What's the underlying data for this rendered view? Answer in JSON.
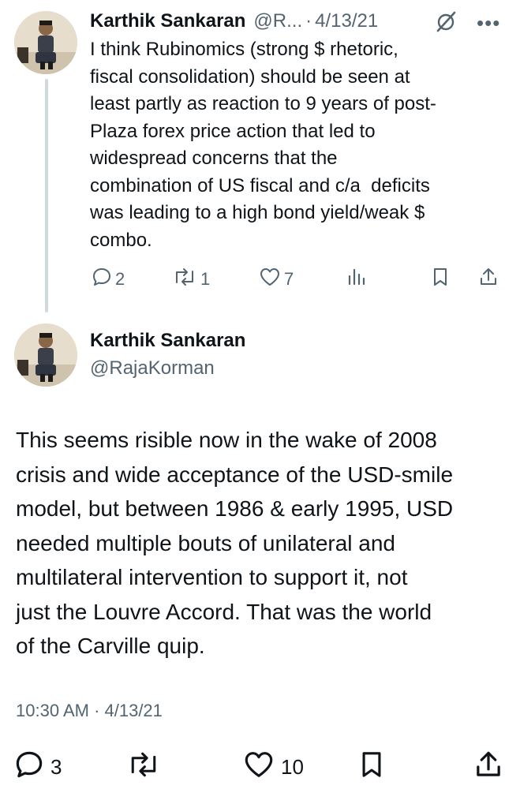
{
  "tweet1": {
    "author_name": "Karthik Sankaran",
    "handle": "@R...",
    "separator": "·",
    "date": "4/13/21",
    "body": "I think Rubinomics (strong $ rhetoric,\nfiscal consolidation) should be seen at\nleast partly as reaction to 9 years of post-\nPlaza forex price action that led to\nwidespread concerns that the\ncombination of US fiscal and c/a  deficits\nwas leading to a high bond yield/weak $\ncombo.",
    "more_icon": "more-icon",
    "grok_icon": "grok-icon",
    "actions": {
      "replies": "2",
      "reposts": "1",
      "likes": "7",
      "views": ""
    }
  },
  "tweet2": {
    "author_name": "Karthik Sankaran",
    "handle": "@RajaKorman",
    "body": "This seems risible now in the wake of 2008\ncrisis and wide acceptance of the USD-smile\nmodel, but between 1986 & early 1995, USD\nneeded multiple bouts of unilateral and\nmultilateral intervention to support it, not\njust the Louvre Accord. That was the world\nof the Carville quip.",
    "timestamp": "10:30 AM · 4/13/21",
    "actions": {
      "replies": "3",
      "reposts": "",
      "likes": "10"
    }
  },
  "colors": {
    "text": "#0f1419",
    "secondary": "#536471",
    "thread_line": "#cfd9de"
  }
}
